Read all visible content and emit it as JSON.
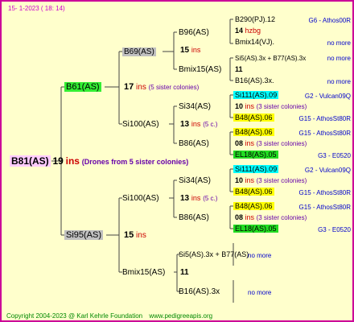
{
  "header": {
    "date": "15- 1-2023 ( 18: 14)"
  },
  "footer": {
    "copyright": "Copyright 2004-2023 @ Karl Kehrle Foundation",
    "site": "www.pedigreeapis.org"
  },
  "root": {
    "name": "B81(AS)",
    "num": "19",
    "ins": "ins",
    "note": "(Drones from 5 sister colonies)"
  },
  "gen1": {
    "mother": {
      "name": "B61(AS)",
      "num": "17",
      "ins": "ins",
      "note": "(5 sister colonies)"
    },
    "father": {
      "name": "Si95(AS)",
      "num": "15",
      "ins": "ins"
    }
  },
  "gen2": {
    "mm": {
      "name": "B69(AS)",
      "num": "15",
      "ins": "ins"
    },
    "mf": {
      "name": "Si100(AS)",
      "num": "13",
      "ins": "ins",
      "note": "(5 c.)"
    },
    "fm": {
      "name": "Si100(AS)",
      "num": "13",
      "ins": "ins",
      "note": "(5 c.)"
    },
    "ff": {
      "name": "Bmix15(AS)",
      "num": "11"
    }
  },
  "gen3": {
    "mmm": {
      "name": "B96(AS)"
    },
    "mmf": {
      "name": "Bmix15(AS)"
    },
    "mfm": {
      "name": "Si34(AS)"
    },
    "mff": {
      "name": "B86(AS)"
    },
    "fmm": {
      "name": "Si34(AS)"
    },
    "fmf": {
      "name": "B86(AS)"
    },
    "ffm": {
      "name": "Si5(AS).3x + B77(AS)"
    },
    "ffmNote": "no more",
    "fff": {
      "name": "B16(AS).3x"
    },
    "fffNote": "no more"
  },
  "gen4": [
    {
      "name": "B290(PJ).12",
      "gen": "G6 - Athos00R"
    },
    {
      "num": "14",
      "extra": "hzbg"
    },
    {
      "name": "Bmix14(VJ).",
      "gen": "no more"
    },
    {
      "name": "Si5(AS).3x + B77(AS).3x",
      "gen": "no more"
    },
    {
      "num": "11"
    },
    {
      "name": "B16(AS).3x.",
      "gen": "no more"
    },
    {
      "name": "Si111(AS).09",
      "gen": "G2 - Vulcan09Q"
    },
    {
      "num": "10",
      "ins": "ins",
      "note": "(3 sister colonies)"
    },
    {
      "name": "B48(AS).06",
      "gen": "G15 - AthosSt80R"
    },
    {
      "name": "B48(AS).06",
      "gen": "G15 - AthosSt80R"
    },
    {
      "num": "08",
      "ins": "ins",
      "note": "(3 sister colonies)"
    },
    {
      "name": "EL18(AS).05",
      "gen": "G3 - E0520"
    },
    {
      "name": "Si111(AS).09",
      "gen": "G2 - Vulcan09Q"
    },
    {
      "num": "10",
      "ins": "ins",
      "note": "(3 sister colonies)"
    },
    {
      "name": "B48(AS).06",
      "gen": "G15 - AthosSt80R"
    },
    {
      "name": "B48(AS).06",
      "gen": "G15 - AthosSt80R"
    },
    {
      "num": "08",
      "ins": "ins",
      "note": "(3 sister colonies)"
    },
    {
      "name": "EL18(AS).05",
      "gen": "G3 - E0520"
    }
  ]
}
